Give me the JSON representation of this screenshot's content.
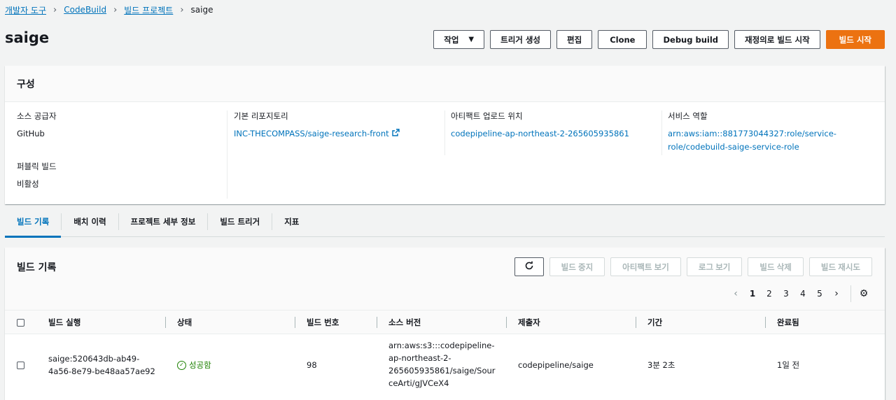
{
  "breadcrumb": {
    "items": [
      "개발자 도구",
      "CodeBuild",
      "빌드 프로젝트"
    ],
    "current": "saige"
  },
  "header": {
    "title": "saige",
    "actions": {
      "action_menu": "작업",
      "create_trigger": "트리거 생성",
      "edit": "편집",
      "clone": "Clone",
      "debug_build": "Debug build",
      "retry_build": "재정의로 빌드 시작",
      "start_build": "빌드 시작"
    }
  },
  "config": {
    "title": "구성",
    "source_provider": {
      "label": "소스 공급자",
      "value": "GitHub"
    },
    "repository": {
      "label": "기본 리포지토리",
      "value": "INC-THECOMPASS/saige-research-front"
    },
    "artifact_location": {
      "label": "아티팩트 업로드 위치",
      "value": "codepipeline-ap-northeast-2-265605935861"
    },
    "service_role": {
      "label": "서비스 역할",
      "value_line1": "arn:aws:iam::881773044327:role/service-",
      "value_line2": "role/codebuild-saige-service-role"
    },
    "public_build": {
      "label": "퍼블릭 빌드",
      "value": "비활성"
    }
  },
  "tabs": [
    "빌드 기록",
    "배치 이력",
    "프로젝트 세부 정보",
    "빌드 트리거",
    "지표"
  ],
  "history": {
    "title": "빌드 기록",
    "buttons": {
      "stop": "빌드 중지",
      "artifacts": "아티팩트 보기",
      "logs": "로그 보기",
      "delete": "빌드 삭제",
      "retry": "빌드 재시도"
    },
    "pages": [
      "1",
      "2",
      "3",
      "4",
      "5"
    ],
    "columns": [
      "빌드 실행",
      "상태",
      "빌드 번호",
      "소스 버전",
      "제출자",
      "기간",
      "완료됨"
    ],
    "rows": [
      {
        "run_line1": "saige:520643db-ab49-",
        "run_line2": "4a56-8e79-be48aa57ae92",
        "status": "성공함",
        "number": "98",
        "source_line1": "arn:aws:s3:::codepipeline-",
        "source_line2": "ap-northeast-2-",
        "source_line3": "265605935861/saige/Sour",
        "source_line4": "ceArti/gJVCeX4",
        "submitter": "codepipeline/saige",
        "duration": "3분 2초",
        "completed": "1일 전"
      }
    ]
  },
  "colors": {
    "accent": "#0073bb",
    "primary": "#ec7211",
    "success": "#1d8102"
  }
}
